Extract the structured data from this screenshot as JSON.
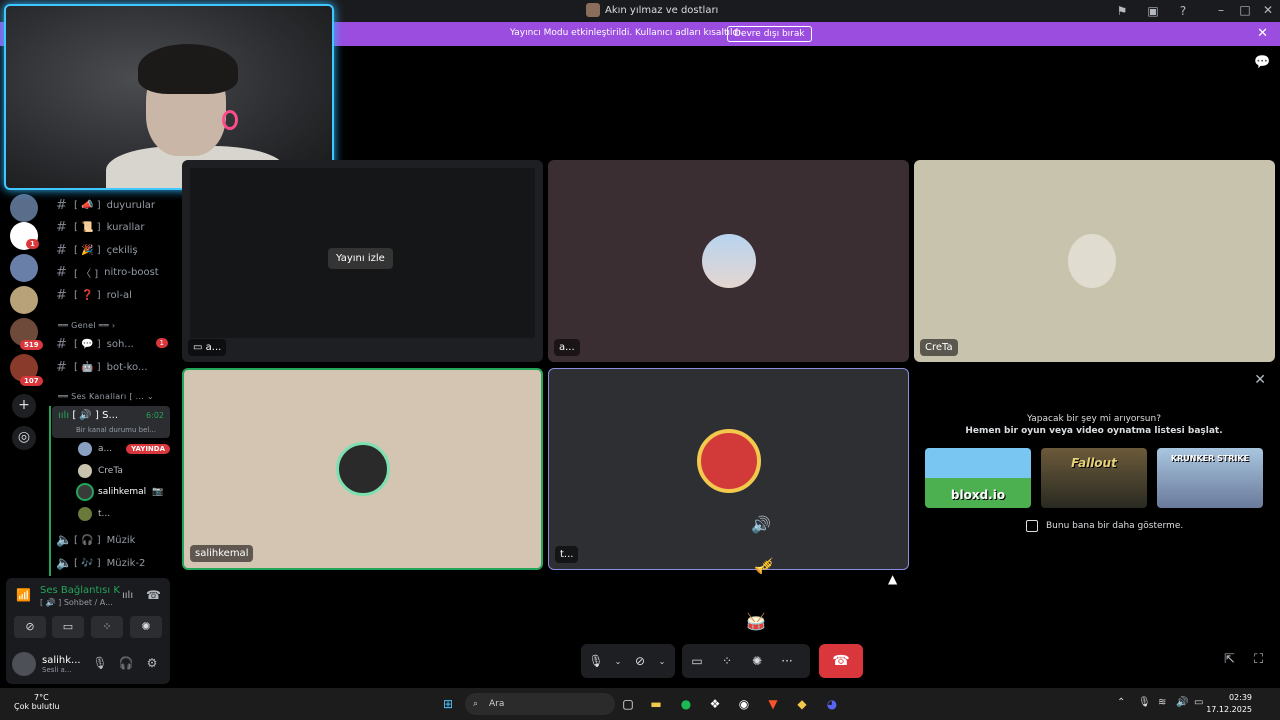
{
  "window": {
    "title": "Akın yılmaz ve dostları"
  },
  "banner": {
    "message": "Yayıncı Modu etkinleştirildi. Kullanıcı adları kısaltıldı.",
    "button": "Devre dışı bırak"
  },
  "rail": {
    "badges": [
      "1",
      "519",
      "107"
    ]
  },
  "channels": {
    "text": [
      {
        "label": "duyurular",
        "prefix": "[ 📣 ]"
      },
      {
        "label": "kurallar",
        "prefix": "[ 📜 ]"
      },
      {
        "label": "çekiliş",
        "prefix": "[ 🎉 ]"
      },
      {
        "label": "nitro-boost",
        "prefix": "[ 〈 ]"
      },
      {
        "label": "rol-al",
        "prefix": "[ ❓ ]"
      }
    ],
    "category_general": "Genel",
    "general": [
      {
        "label": "soh...",
        "prefix": "[ 💬 ]",
        "unread": "1"
      },
      {
        "label": "bot-ko...",
        "prefix": "[ 🤖 ]"
      }
    ],
    "category_voice": "Ses Kanalları [ ...",
    "voice_active": {
      "label": "S...",
      "prefix": "[ 🔊 ]",
      "time": "6:02",
      "status": "Bir kanal durumu bel..."
    },
    "members": [
      {
        "name": "a...",
        "live": "YAYINDA"
      },
      {
        "name": "CreTa"
      },
      {
        "name": "salihkemal"
      },
      {
        "name": "t..."
      }
    ],
    "voice_other": [
      {
        "label": "Müzik",
        "prefix": "[ 🎧 ]"
      },
      {
        "label": "Müzik-2",
        "prefix": "[ 🎶 ]"
      }
    ]
  },
  "voice_connection": {
    "state": "Ses Bağlantısı K",
    "sub": "[ 🔊 ] Sohbet / A..."
  },
  "user": {
    "name": "salihk...",
    "status": "Sesli a..."
  },
  "tiles": [
    {
      "label": "a...",
      "watch": "Yayını izle"
    },
    {
      "label": "a..."
    },
    {
      "label": "CreTa"
    },
    {
      "label": "salihkemal"
    },
    {
      "label": "t..."
    }
  ],
  "activity": {
    "question": "Yapacak bir şey mi arıyorsun?",
    "prompt": "Hemen bir oyun veya video oynatma listesi başlat.",
    "games": [
      "bloxd.io",
      "Fallout",
      "KRUNKER STRIKE"
    ],
    "dont_show": "Bunu bana bir daha gösterme."
  },
  "taskbar": {
    "temp": "7°C",
    "weather": "Çok bulutlu",
    "search": "Ara",
    "time": "02:39",
    "date": "17.12.2025"
  },
  "colors": {
    "accent": "#9b4de0",
    "danger": "#da373c",
    "online": "#23a55a",
    "camera_glow": "#3fc7ff"
  }
}
